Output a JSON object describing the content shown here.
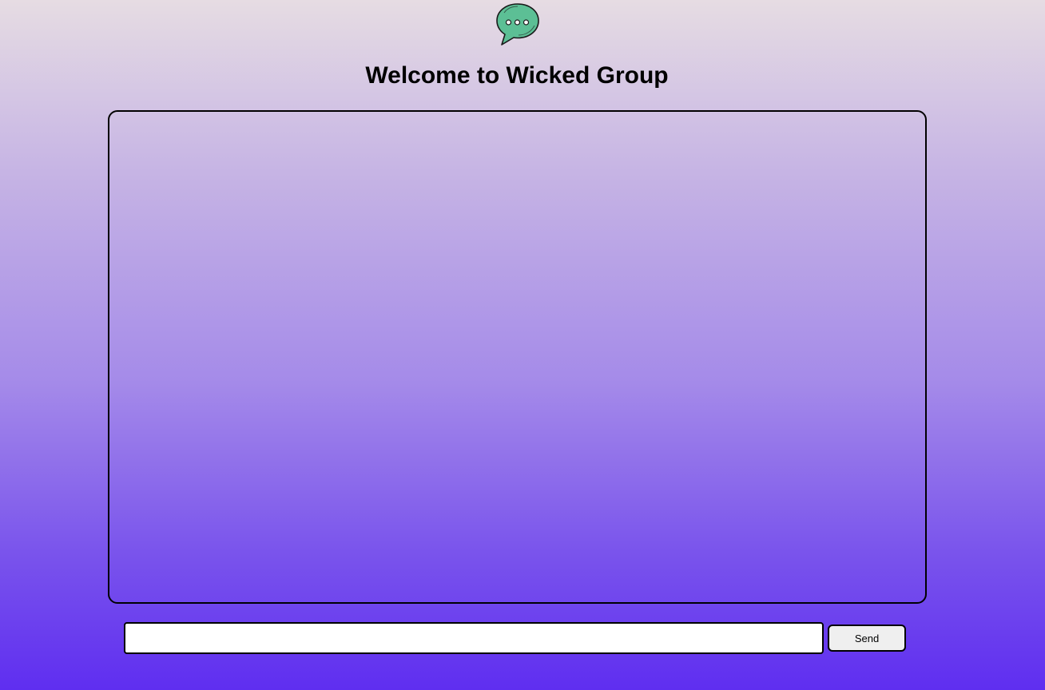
{
  "header": {
    "logo_icon": "chat-bubble-icon",
    "title": "Welcome to Wicked Group"
  },
  "chat": {
    "messages": []
  },
  "composer": {
    "input_value": "",
    "input_placeholder": "",
    "send_label": "Send"
  },
  "colors": {
    "logo_fill": "#5cbf95",
    "background_top": "#e6dce3",
    "background_bottom": "#5f2ef0"
  }
}
